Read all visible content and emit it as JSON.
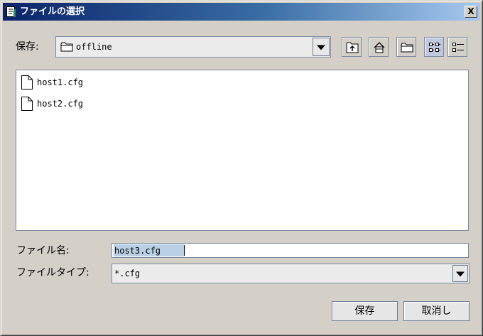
{
  "window": {
    "title": "ファイルの選択",
    "close_label": "X"
  },
  "look_in": {
    "label": "保存:",
    "value": "offline"
  },
  "toolbar": {
    "buttons": [
      {
        "icon": "up-folder-icon"
      },
      {
        "icon": "home-icon"
      },
      {
        "icon": "new-folder-icon"
      },
      {
        "icon": "list-view-icon",
        "active": true
      },
      {
        "icon": "details-view-icon"
      }
    ]
  },
  "files": [
    {
      "name": "host1.cfg",
      "icon": "file-icon"
    },
    {
      "name": "host2.cfg",
      "icon": "file-icon"
    }
  ],
  "file_name": {
    "label": "ファイル名:",
    "value": "host3.cfg"
  },
  "file_type": {
    "label": "ファイルタイプ:",
    "value": "*.cfg"
  },
  "buttons": {
    "save": "保存",
    "cancel": "取消し"
  },
  "colors": {
    "title_start": "#0a246a",
    "title_end": "#a6caf0",
    "background": "#d4d0c8",
    "border": "#7a8aa2"
  }
}
